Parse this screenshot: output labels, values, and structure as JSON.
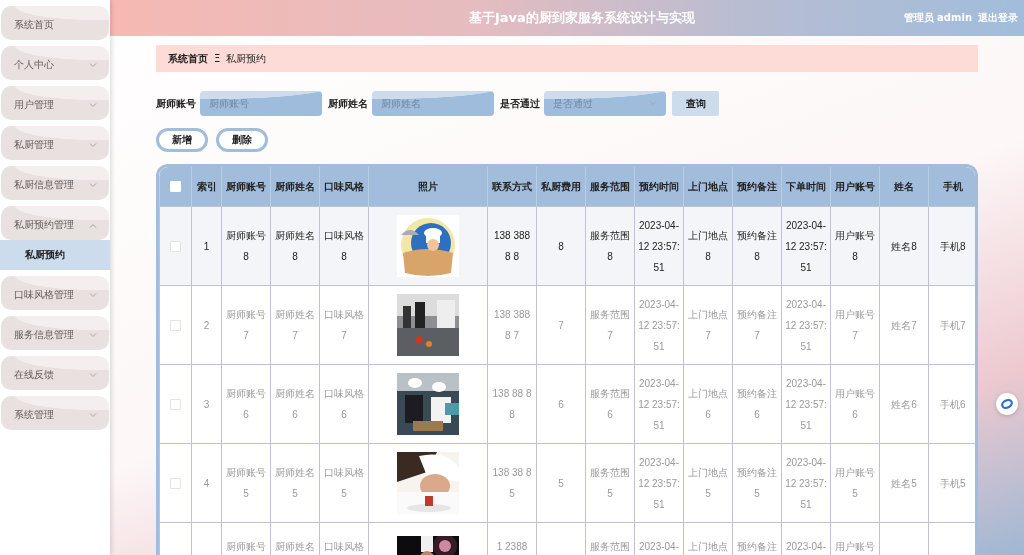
{
  "header": {
    "title": "基于Java的厨到家服务系统设计与实现",
    "user": "管理员 admin",
    "logout": "退出登录"
  },
  "sidebar": {
    "items": [
      {
        "label": "系统首页"
      },
      {
        "label": "个人中心",
        "expanded": false
      },
      {
        "label": "用户管理",
        "expanded": false
      },
      {
        "label": "私厨管理",
        "expanded": false
      },
      {
        "label": "私厨信息管理",
        "expanded": false
      },
      {
        "label": "私厨预约管理",
        "expanded": true,
        "children": [
          {
            "label": "私厨预约",
            "selected": true
          }
        ]
      },
      {
        "label": "口味风格管理",
        "expanded": false
      },
      {
        "label": "服务信息管理",
        "expanded": false
      },
      {
        "label": "在线反馈",
        "expanded": false
      },
      {
        "label": "系统管理",
        "expanded": false
      }
    ]
  },
  "breadcrumb": {
    "home": "系统首页",
    "separator": "Ξ",
    "current": "私厨预约"
  },
  "search": {
    "fields": [
      {
        "kind": "text",
        "label": "厨师账号",
        "placeholder": "厨师账号"
      },
      {
        "kind": "text",
        "label": "厨师姓名",
        "placeholder": "厨师姓名"
      },
      {
        "kind": "select",
        "label": "是否通过",
        "placeholder": "是否通过"
      }
    ],
    "button": "查询"
  },
  "actions": [
    "新增",
    "删除"
  ],
  "table": {
    "header_checked": false,
    "columns": [
      {
        "kind": "check"
      },
      {
        "kind": "text",
        "label": "索引"
      },
      {
        "kind": "text",
        "label": "厨师账号"
      },
      {
        "kind": "text",
        "label": "厨师姓名"
      },
      {
        "kind": "text",
        "label": "口味风格"
      },
      {
        "label": "照片"
      },
      {
        "kind": "text",
        "label": "联系方式"
      },
      {
        "kind": "text",
        "label": "私厨费用"
      },
      {
        "kind": "text",
        "label": "服务范围"
      },
      {
        "kind": "text",
        "label": "预约时间"
      },
      {
        "kind": "text",
        "label": "上门地点"
      },
      {
        "kind": "text",
        "label": "预约备注"
      },
      {
        "kind": "text",
        "label": "下单时间"
      },
      {
        "kind": "text",
        "label": "用户账号"
      },
      {
        "kind": "text",
        "label": "姓名"
      },
      {
        "kind": "text",
        "label": "手机"
      }
    ],
    "rows": [
      {
        "selected": true,
        "checked": false,
        "cells": [
          "",
          "1",
          "厨师账号8",
          "厨师姓名8",
          "口味风格8",
          "",
          "138 388 8 8",
          "8",
          "服务范围8",
          "2023-04-12 23:57:51",
          "上门地点8",
          "预约备注8",
          "2023-04-12 23:57:51",
          "用户账号8",
          "姓名8",
          "手机8"
        ]
      },
      {
        "selected": false,
        "checked": false,
        "cells": [
          "",
          "2",
          "厨师账号7",
          "厨师姓名7",
          "口味风格7",
          "",
          "138 388 8 7",
          "7",
          "服务范围7",
          "2023-04-12 23:57:51",
          "上门地点7",
          "预约备注7",
          "2023-04-12 23:57:51",
          "用户账号7",
          "姓名7",
          "手机7"
        ]
      },
      {
        "selected": false,
        "checked": false,
        "cells": [
          "",
          "3",
          "厨师账号6",
          "厨师姓名6",
          "口味风格6",
          "",
          "138 88 88",
          "6",
          "服务范围6",
          "2023-04-12 23:57:51",
          "上门地点6",
          "预约备注6",
          "2023-04-12 23:57:51",
          "用户账号6",
          "姓名6",
          "手机6"
        ]
      },
      {
        "selected": false,
        "checked": false,
        "cells": [
          "",
          "4",
          "厨师账号5",
          "厨师姓名5",
          "口味风格5",
          "",
          "138 38 8 5",
          "5",
          "服务范围5",
          "2023-04-12 23:57:51",
          "上门地点5",
          "预约备注5",
          "2023-04-12 23:57:51",
          "用户账号5",
          "姓名5",
          "手机5"
        ]
      },
      {
        "selected": false,
        "partial": true,
        "cells": [
          "",
          "",
          "厨师账号",
          "厨师姓名",
          "口味风格",
          "",
          "1 2388",
          "",
          "服务范围",
          "2023-04-",
          "上门地点",
          "预约备注",
          "2023-04-",
          "用户账号",
          "",
          ""
        ]
      }
    ]
  }
}
